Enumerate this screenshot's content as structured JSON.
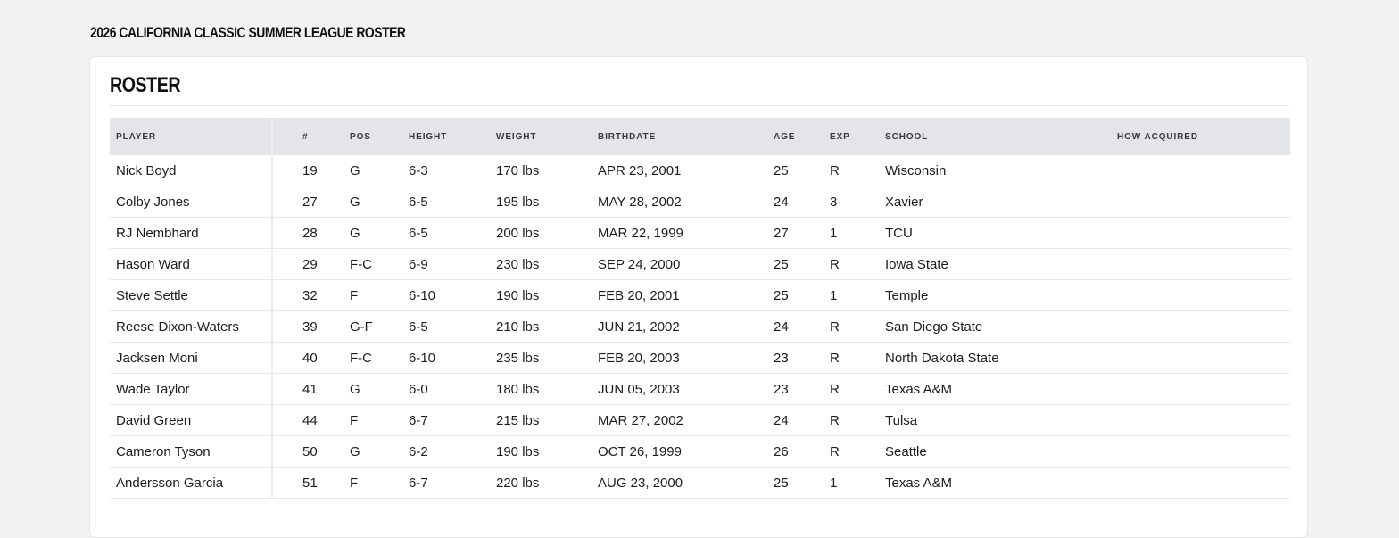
{
  "page": {
    "title": "2026 CALIFORNIA CLASSIC SUMMER LEAGUE ROSTER"
  },
  "roster": {
    "section_title": "ROSTER",
    "columns": [
      "PLAYER",
      "#",
      "POS",
      "HEIGHT",
      "WEIGHT",
      "BIRTHDATE",
      "AGE",
      "EXP",
      "SCHOOL",
      "HOW ACQUIRED"
    ],
    "rows": [
      {
        "player": "Nick Boyd",
        "number": "19",
        "pos": "G",
        "height": "6-3",
        "weight": "170 lbs",
        "birthdate": "APR 23, 2001",
        "age": "25",
        "exp": "R",
        "school": "Wisconsin",
        "how_acquired": ""
      },
      {
        "player": "Colby Jones",
        "number": "27",
        "pos": "G",
        "height": "6-5",
        "weight": "195 lbs",
        "birthdate": "MAY 28, 2002",
        "age": "24",
        "exp": "3",
        "school": "Xavier",
        "how_acquired": ""
      },
      {
        "player": "RJ Nembhard",
        "number": "28",
        "pos": "G",
        "height": "6-5",
        "weight": "200 lbs",
        "birthdate": "MAR 22, 1999",
        "age": "27",
        "exp": "1",
        "school": "TCU",
        "how_acquired": ""
      },
      {
        "player": "Hason Ward",
        "number": "29",
        "pos": "F-C",
        "height": "6-9",
        "weight": "230 lbs",
        "birthdate": "SEP 24, 2000",
        "age": "25",
        "exp": "R",
        "school": "Iowa State",
        "how_acquired": ""
      },
      {
        "player": "Steve Settle",
        "number": "32",
        "pos": "F",
        "height": "6-10",
        "weight": "190 lbs",
        "birthdate": "FEB 20, 2001",
        "age": "25",
        "exp": "1",
        "school": "Temple",
        "how_acquired": ""
      },
      {
        "player": "Reese Dixon-Waters",
        "number": "39",
        "pos": "G-F",
        "height": "6-5",
        "weight": "210 lbs",
        "birthdate": "JUN 21, 2002",
        "age": "24",
        "exp": "R",
        "school": "San Diego State",
        "how_acquired": ""
      },
      {
        "player": "Jacksen Moni",
        "number": "40",
        "pos": "F-C",
        "height": "6-10",
        "weight": "235 lbs",
        "birthdate": "FEB 20, 2003",
        "age": "23",
        "exp": "R",
        "school": "North Dakota State",
        "how_acquired": ""
      },
      {
        "player": "Wade Taylor",
        "number": "41",
        "pos": "G",
        "height": "6-0",
        "weight": "180 lbs",
        "birthdate": "JUN 05, 2003",
        "age": "23",
        "exp": "R",
        "school": "Texas A&M",
        "how_acquired": ""
      },
      {
        "player": "David Green",
        "number": "44",
        "pos": "F",
        "height": "6-7",
        "weight": "215 lbs",
        "birthdate": "MAR 27, 2002",
        "age": "24",
        "exp": "R",
        "school": "Tulsa",
        "how_acquired": ""
      },
      {
        "player": "Cameron Tyson",
        "number": "50",
        "pos": "G",
        "height": "6-2",
        "weight": "190 lbs",
        "birthdate": "OCT 26, 1999",
        "age": "26",
        "exp": "R",
        "school": "Seattle",
        "how_acquired": ""
      },
      {
        "player": "Andersson Garcia",
        "number": "51",
        "pos": "F",
        "height": "6-7",
        "weight": "220 lbs",
        "birthdate": "AUG 23, 2000",
        "age": "25",
        "exp": "1",
        "school": "Texas A&M",
        "how_acquired": ""
      }
    ]
  }
}
